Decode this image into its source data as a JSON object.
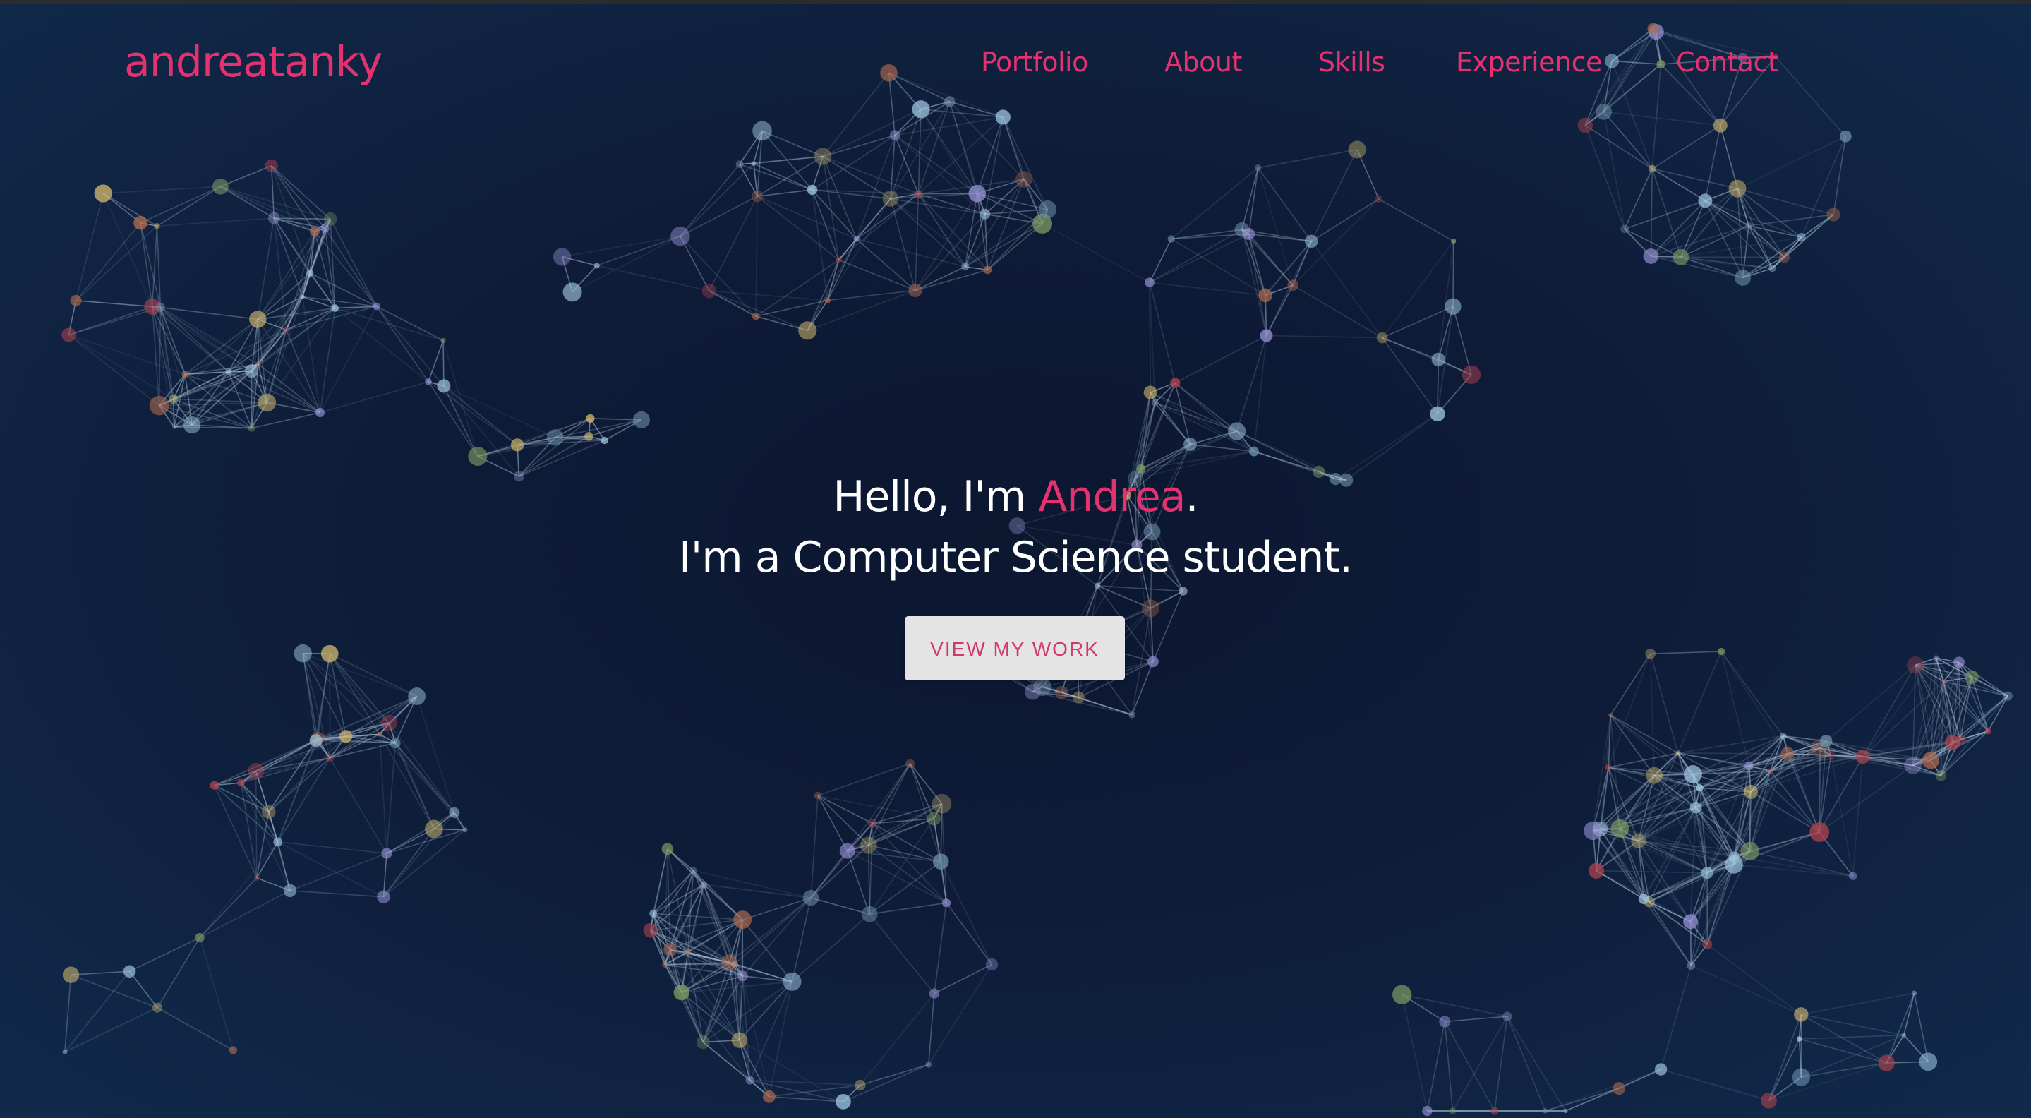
{
  "brand": {
    "name": "andreatanky",
    "accent_color": "#e3326f"
  },
  "nav": {
    "items": [
      {
        "label": "Portfolio"
      },
      {
        "label": "About"
      },
      {
        "label": "Skills"
      },
      {
        "label": "Experience"
      },
      {
        "label": "Contact"
      }
    ]
  },
  "hero": {
    "greeting": "Hello, I'm ",
    "name": "Andrea",
    "greeting_end": ".",
    "tagline": "I'm a Computer Science student.",
    "cta_label": "VIEW MY WORK"
  },
  "theme": {
    "background_color": "#0e1c38",
    "text_color": "#ffffff",
    "button_bg": "#e4e4e4"
  }
}
